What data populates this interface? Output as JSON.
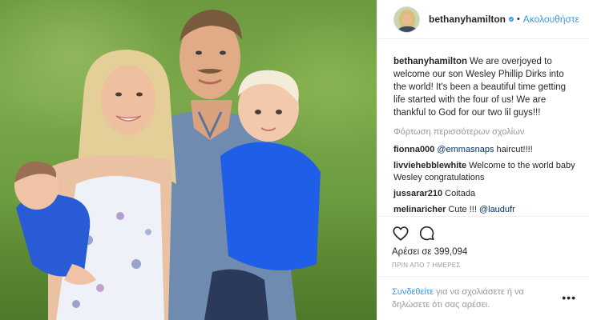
{
  "post": {
    "username": "bethanyhamilton",
    "follow_label": "Ακολουθήστε",
    "dot": "•",
    "caption": "We are overjoyed to welcome our son Wesley Phillip Dirks into the world! It's been a beautiful time getting life started with the four of us! We are thankful to God for our two lil guys!!!",
    "load_more": "Φόρτωση περισσότερων σχολίων",
    "comments": [
      {
        "user": "fionna000",
        "mention": "@emmasnaps",
        "text": " haircut!!!!"
      },
      {
        "user": "livviehebblewhite",
        "mention": "",
        "text": "Welcome to the world baby Wesley congratulations"
      },
      {
        "user": "jussarar210",
        "mention": "",
        "text": "Coitada"
      },
      {
        "user": "melinaricher",
        "mention": "@laudufr",
        "text": "Cute !!! "
      }
    ],
    "likes": "Αρέσει σε 399,094",
    "time": "ΠΡΙΝ ΑΠΟ 7 ΗΜΕΡΕΣ",
    "login_link": "Συνδεθείτε",
    "login_text": " για να σχολιάσετε ή να δηλώσετε ότι σας αρέσει.",
    "more_label": "•••"
  },
  "icons": {
    "heart": "heart-icon",
    "comment": "comment-icon",
    "verified": "verified-badge-icon",
    "more": "more-options-icon"
  },
  "colors": {
    "link_blue": "#3897f0",
    "verified_blue": "#3897f0",
    "muted": "#999999"
  }
}
